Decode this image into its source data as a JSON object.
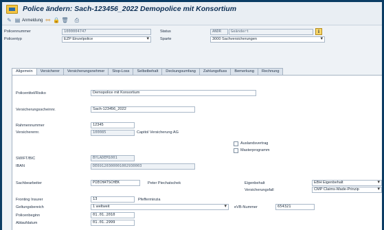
{
  "window": {
    "title": "Police ändern: Sach-123456_2022 Demopolice mit Konsortium"
  },
  "toolbar": {
    "anmeldung_label": "Anmeldung"
  },
  "header": {
    "policennummer_label": "Policennummer",
    "policennummer_value": "1000004747",
    "policentyp_label": "Policentyp",
    "policentyp_value": "EZP Einzelpolice",
    "status_label": "Status",
    "status_code": "ÄNDR",
    "status_text": "Geändert",
    "sparte_label": "Sparte",
    "sparte_value": "3000 Sachversicherungen"
  },
  "tabs": [
    {
      "label": "Allgemein",
      "active": true
    },
    {
      "label": "Versicherer",
      "active": false
    },
    {
      "label": "Versicherungsnehmer",
      "active": false
    },
    {
      "label": "Stop-Loss",
      "active": false
    },
    {
      "label": "Selbstbehalt",
      "active": false
    },
    {
      "label": "Deckungsumfang",
      "active": false
    },
    {
      "label": "Zahlungsfluss",
      "active": false
    },
    {
      "label": "Bemerkung",
      "active": false
    },
    {
      "label": "Rechnung",
      "active": false
    }
  ],
  "form": {
    "policentitel_label": "Policentitel/Risiko",
    "policentitel_value": "Demopolice mit Konsortium",
    "versicherungsschein_label": "Versicherungsscheinnr.",
    "versicherungsschein_value": "Sach-123456_2022",
    "rahmennummer_label": "Rahmennummer",
    "rahmennummer_value": "12345",
    "versicherernr_label": "Versicherernr.",
    "versicherernr_value": "100085",
    "versicherer_name": "Capitol Versicherung AG",
    "auslandsvertrag_label": "Auslandsvertrag",
    "masterprogramm_label": "Masterprogramm",
    "swift_label": "SWIFT/BIC",
    "swift_value": "BYLADEM1001",
    "iban_label": "IBAN",
    "iban_value": "DE69120300001002930003",
    "sachbearbeiter_label": "Sachbearbeiter",
    "sachbearbeiter_value": "PIECHATSCHEK",
    "sachbearbeiter_name": "Peter Piechatschek",
    "eigenbehalt_label": "Eigenbehalt",
    "eigenbehalt_value": "EBH Eigenbehalt",
    "versicherungsfall_label": "Versicherungsfall",
    "versicherungsfall_value": "CMP Claims-Made-Prinzip",
    "fronting_label": "Fronting Insurer",
    "fronting_value": "13",
    "fronting_name": "Pfefferminzia",
    "geltungsbereich_label": "Geltungsbereich",
    "geltungsbereich_value": "1 weltweit",
    "evb_label": "eVB-Nummer",
    "evb_value": "654321",
    "policenbeginn_label": "Policenbeginn",
    "policenbeginn_value": "01.01.2010",
    "ablaufdatum_label": "Ablaufdatum",
    "ablaufdatum_value": "01.01.2999"
  }
}
